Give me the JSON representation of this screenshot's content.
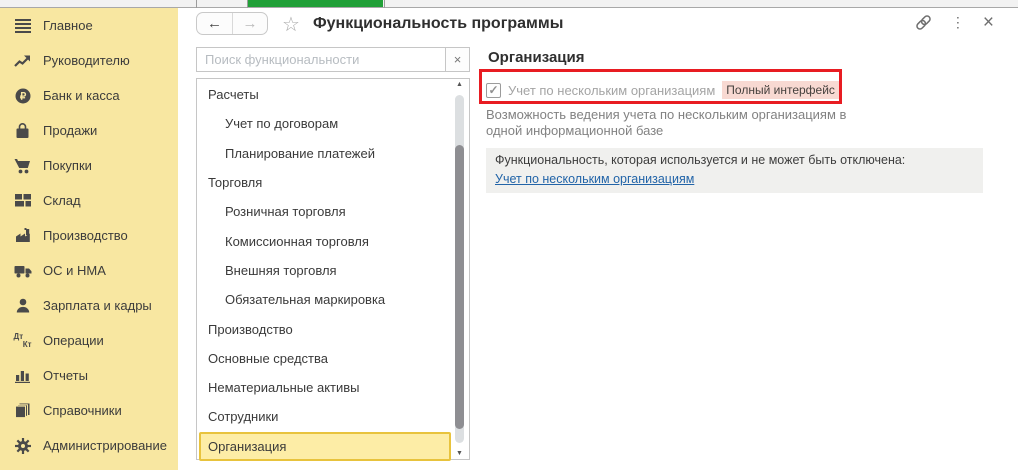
{
  "header": {
    "title": "Функциональность программы"
  },
  "sidebar": {
    "operations_icon": {
      "top": "Дт",
      "bottom": "Кт"
    },
    "items": [
      {
        "label": "Главное",
        "icon": "menu-icon"
      },
      {
        "label": "Руководителю",
        "icon": "trend-icon"
      },
      {
        "label": "Банк и касса",
        "icon": "ruble-icon"
      },
      {
        "label": "Продажи",
        "icon": "bag-icon"
      },
      {
        "label": "Покупки",
        "icon": "cart-icon"
      },
      {
        "label": "Склад",
        "icon": "grid-icon"
      },
      {
        "label": "Производство",
        "icon": "factory-icon"
      },
      {
        "label": "ОС и НМА",
        "icon": "truck-icon"
      },
      {
        "label": "Зарплата и кадры",
        "icon": "person-icon"
      },
      {
        "label": "Операции",
        "icon": "dt-kt-icon"
      },
      {
        "label": "Отчеты",
        "icon": "chart-icon"
      },
      {
        "label": "Справочники",
        "icon": "books-icon"
      },
      {
        "label": "Администрирование",
        "icon": "gear-icon"
      }
    ]
  },
  "search": {
    "placeholder": "Поиск функциональности",
    "value": ""
  },
  "features": {
    "items": [
      {
        "label": "Расчеты",
        "level": 0
      },
      {
        "label": "Учет по договорам",
        "level": 1
      },
      {
        "label": "Планирование платежей",
        "level": 1
      },
      {
        "label": "Торговля",
        "level": 0
      },
      {
        "label": "Розничная торговля",
        "level": 1
      },
      {
        "label": "Комиссионная торговля",
        "level": 1
      },
      {
        "label": "Внешняя торговля",
        "level": 1
      },
      {
        "label": "Обязательная маркировка",
        "level": 1
      },
      {
        "label": "Производство",
        "level": 0
      },
      {
        "label": "Основные средства",
        "level": 0
      },
      {
        "label": "Нематериальные активы",
        "level": 0
      },
      {
        "label": "Сотрудники",
        "level": 0
      },
      {
        "label": "Организация",
        "level": 0,
        "selected": true
      }
    ]
  },
  "panel": {
    "heading": "Организация",
    "checkbox": {
      "label": "Учет по нескольким организациям",
      "checked": true,
      "disabled": true
    },
    "badge": "Полный интерфейс",
    "description": "Возможность ведения учета по нескольким организациям в одной информационной базе",
    "info_box": {
      "text": "Функциональность, которая используется и не может быть отключена:",
      "link": "Учет по нескольким организациям"
    }
  },
  "glyphs": {
    "back": "←",
    "forward": "→",
    "star": "☆",
    "more": "⋮",
    "close": "×",
    "clear": "×",
    "scroll_up": "▲",
    "scroll_down": "▼",
    "check": "✓",
    "ruble": "₽"
  },
  "colors": {
    "sidebar_bg": "#f8e7a1",
    "selected_item_bg": "#fdeda6",
    "selected_item_border": "#e8c33d",
    "active_tab_green": "#21a038",
    "annotation_red": "#e81c22",
    "badge_bg": "#f8d9d2",
    "link_blue": "#2264a8"
  }
}
